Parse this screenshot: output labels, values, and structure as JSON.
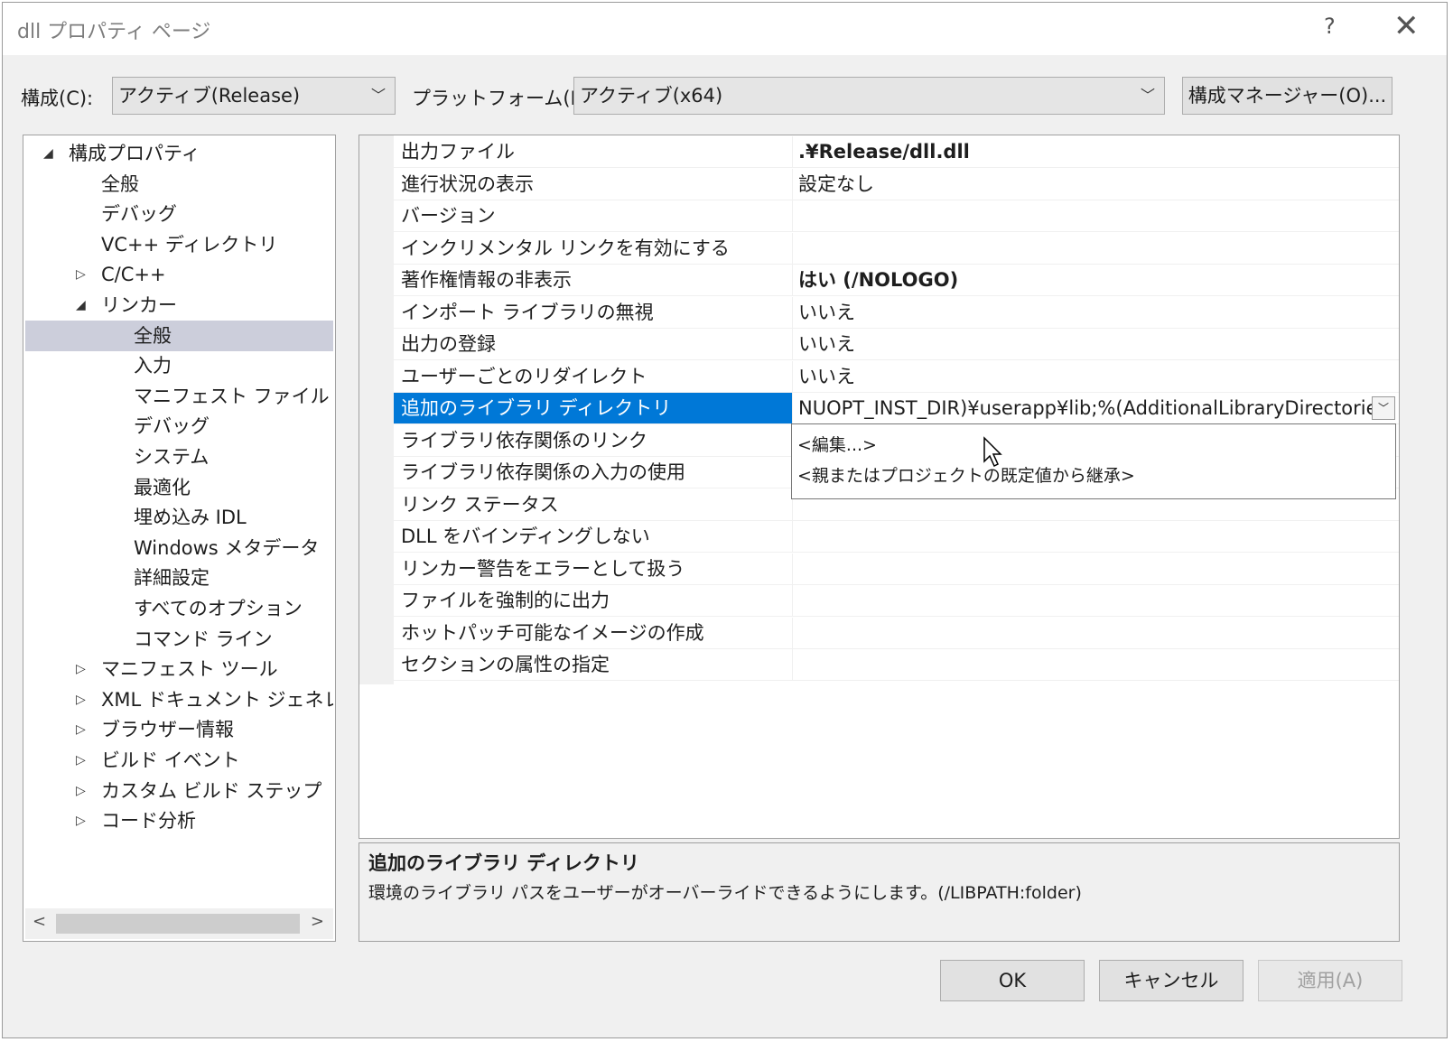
{
  "window": {
    "title": "dll プロパティ ページ",
    "help": "?",
    "close": "✕"
  },
  "toolbar": {
    "config_label": "構成(C):",
    "config_value": "アクティブ(Release)",
    "platform_label": "プラットフォーム(P):",
    "platform_value": "アクティブ(x64)",
    "manager_button": "構成マネージャー(O)..."
  },
  "tree": {
    "items": [
      {
        "label": "構成プロパティ",
        "level": 0,
        "arrow": "◢"
      },
      {
        "label": "全般",
        "level": 1
      },
      {
        "label": "デバッグ",
        "level": 1
      },
      {
        "label": "VC++ ディレクトリ",
        "level": 1
      },
      {
        "label": "C/C++",
        "level": 1,
        "arrow": "▷"
      },
      {
        "label": "リンカー",
        "level": 1,
        "arrow": "◢"
      },
      {
        "label": "全般",
        "level": 2,
        "selected": true
      },
      {
        "label": "入力",
        "level": 2
      },
      {
        "label": "マニフェスト ファイル",
        "level": 2
      },
      {
        "label": "デバッグ",
        "level": 2
      },
      {
        "label": "システム",
        "level": 2
      },
      {
        "label": "最適化",
        "level": 2
      },
      {
        "label": "埋め込み IDL",
        "level": 2
      },
      {
        "label": "Windows メタデータ",
        "level": 2
      },
      {
        "label": "詳細設定",
        "level": 2
      },
      {
        "label": "すべてのオプション",
        "level": 2
      },
      {
        "label": "コマンド ライン",
        "level": 2
      },
      {
        "label": "マニフェスト ツール",
        "level": 1,
        "arrow": "▷"
      },
      {
        "label": "XML ドキュメント ジェネレーター",
        "level": 1,
        "arrow": "▷"
      },
      {
        "label": "ブラウザー情報",
        "level": 1,
        "arrow": "▷"
      },
      {
        "label": "ビルド イベント",
        "level": 1,
        "arrow": "▷"
      },
      {
        "label": "カスタム ビルド ステップ",
        "level": 1,
        "arrow": "▷"
      },
      {
        "label": "コード分析",
        "level": 1,
        "arrow": "▷"
      }
    ],
    "scroll_left": "<",
    "scroll_right": ">"
  },
  "properties": [
    {
      "name": "出力ファイル",
      "value": ".¥Release/dll.dll",
      "bold": true
    },
    {
      "name": "進行状況の表示",
      "value": "設定なし"
    },
    {
      "name": "バージョン",
      "value": ""
    },
    {
      "name": "インクリメンタル リンクを有効にする",
      "value": ""
    },
    {
      "name": "著作権情報の非表示",
      "value": "はい (/NOLOGO)",
      "bold": true
    },
    {
      "name": "インポート ライブラリの無視",
      "value": "いいえ"
    },
    {
      "name": "出力の登録",
      "value": "いいえ"
    },
    {
      "name": "ユーザーごとのリダイレクト",
      "value": "いいえ"
    },
    {
      "name": "追加のライブラリ ディレクトリ",
      "value": "NUOPT_INST_DIR)¥userapp¥lib;%(AdditionalLibraryDirectories)",
      "selected": true
    },
    {
      "name": "ライブラリ依存関係のリンク",
      "value": ""
    },
    {
      "name": "ライブラリ依存関係の入力の使用",
      "value": ""
    },
    {
      "name": "リンク ステータス",
      "value": ""
    },
    {
      "name": "DLL をバインディングしない",
      "value": ""
    },
    {
      "name": "リンカー警告をエラーとして扱う",
      "value": ""
    },
    {
      "name": "ファイルを強制的に出力",
      "value": ""
    },
    {
      "name": "ホットパッチ可能なイメージの作成",
      "value": ""
    },
    {
      "name": "セクションの属性の指定",
      "value": ""
    }
  ],
  "dropdown": {
    "items": [
      "<編集...>",
      "<親またはプロジェクトの既定値から継承>"
    ]
  },
  "description": {
    "title": "追加のライブラリ ディレクトリ",
    "text": "環境のライブラリ パスをユーザーがオーバーライドできるようにします。(/LIBPATH:folder)"
  },
  "buttons": {
    "ok": "OK",
    "cancel": "キャンセル",
    "apply": "適用(A)"
  },
  "colors": {
    "selection_accent": "#0078d7",
    "tree_selection": "#cccedb"
  }
}
